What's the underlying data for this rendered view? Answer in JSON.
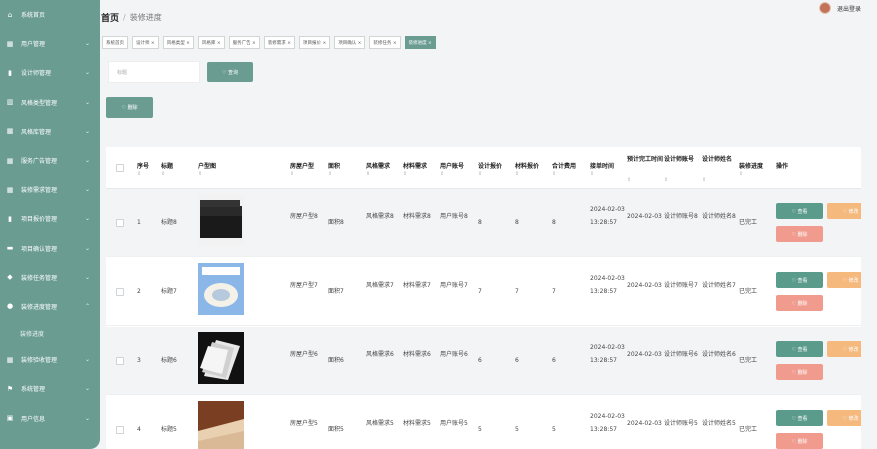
{
  "sidebar": {
    "items": [
      {
        "label": "系统首页",
        "icon": "home-icon",
        "glyph": "⌂",
        "chevron": false
      },
      {
        "label": "用户管理",
        "icon": "grid-icon",
        "glyph": "▦",
        "chevron": true
      },
      {
        "label": "设计师管理",
        "icon": "document-icon",
        "glyph": "▮",
        "chevron": true
      },
      {
        "label": "风格类型管理",
        "icon": "bar-chart-icon",
        "glyph": "▥",
        "chevron": true
      },
      {
        "label": "风格库管理",
        "icon": "grid-icon",
        "glyph": "▦",
        "chevron": true
      },
      {
        "label": "服务广告管理",
        "icon": "grid-icon",
        "glyph": "▦",
        "chevron": true
      },
      {
        "label": "装修需求管理",
        "icon": "grid-icon",
        "glyph": "▦",
        "chevron": true
      },
      {
        "label": "项目报价管理",
        "icon": "document-icon",
        "glyph": "▮",
        "chevron": true
      },
      {
        "label": "项目确认管理",
        "icon": "message-icon",
        "glyph": "▬",
        "chevron": true
      },
      {
        "label": "装修任务管理",
        "icon": "tag-icon",
        "glyph": "◆",
        "chevron": true
      },
      {
        "label": "装修进度管理",
        "icon": "person-icon",
        "glyph": "●",
        "chevron": true,
        "expanded": true
      }
    ],
    "subitem": "装修进度",
    "items_after": [
      {
        "label": "装修验收管理",
        "icon": "grid-icon",
        "glyph": "▦",
        "chevron": true
      },
      {
        "label": "系统管理",
        "icon": "flag-icon",
        "glyph": "⚑",
        "chevron": true
      },
      {
        "label": "用户信息",
        "icon": "calendar-icon",
        "glyph": "▣",
        "chevron": true
      }
    ]
  },
  "header": {
    "breadcrumb_home": "首页",
    "breadcrumb_sep": "/",
    "breadcrumb_current": "装修进度",
    "logout": "退出登录"
  },
  "tabs": [
    "系统首页",
    "设计师 ×",
    "风格类型 ×",
    "风格库 ×",
    "服务广告 ×",
    "装修需求 ×",
    "项目报价 ×",
    "项目确认 ×",
    "装修任务 ×",
    "装修进度 ×"
  ],
  "search": {
    "placeholder": "标题",
    "button": "♡ 查询"
  },
  "delete_button": "♡ 删除",
  "table": {
    "headers": [
      "序号",
      "标题",
      "户型图",
      "房屋户型",
      "面积",
      "风格需求",
      "材料需求",
      "用户账号",
      "设计报价",
      "材料报价",
      "合计费用",
      "接单时间",
      "预计完工时间",
      "设计师账号",
      "设计师姓名",
      "装修进度",
      "操作"
    ],
    "rows": [
      {
        "no": "1",
        "title": "标题8",
        "house": "房屋户型8",
        "area": "面积8",
        "style": "风格需求8",
        "material": "材料需求8",
        "account": "用户账号8",
        "design_quote": "8",
        "material_quote": "8",
        "total": "8",
        "accept_time": "2024-02-03 13:28:57",
        "finish_time": "2024-02-03",
        "designer_acct": "设计师账号8",
        "designer_name": "设计师姓名8",
        "progress": "已完工",
        "thumb": "black-foam"
      },
      {
        "no": "2",
        "title": "标题7",
        "house": "房屋户型7",
        "area": "面积7",
        "style": "风格需求7",
        "material": "材料需求7",
        "account": "用户账号7",
        "design_quote": "7",
        "material_quote": "7",
        "total": "7",
        "accept_time": "2024-02-03 13:28:57",
        "finish_time": "2024-02-03",
        "designer_acct": "设计师账号7",
        "designer_name": "设计师姓名7",
        "progress": "已完工",
        "thumb": "tape-roll"
      },
      {
        "no": "3",
        "title": "标题6",
        "house": "房屋户型6",
        "area": "面积6",
        "style": "风格需求6",
        "material": "材料需求6",
        "account": "用户账号6",
        "design_quote": "6",
        "material_quote": "6",
        "total": "6",
        "accept_time": "2024-02-03 13:28:57",
        "finish_time": "2024-02-03",
        "designer_acct": "设计师账号6",
        "designer_name": "设计师姓名6",
        "progress": "已完工",
        "thumb": "white-sheets"
      },
      {
        "no": "4",
        "title": "标题5",
        "house": "房屋户型5",
        "area": "面积5",
        "style": "风格需求5",
        "material": "材料需求5",
        "account": "用户账号5",
        "design_quote": "5",
        "material_quote": "5",
        "total": "5",
        "accept_time": "2024-02-03 13:28:57",
        "finish_time": "2024-02-03",
        "designer_acct": "设计师账号5",
        "designer_name": "设计师姓名5",
        "progress": "已完工",
        "thumb": "wood-board"
      }
    ],
    "actions": {
      "view": "♡ 查看",
      "edit": "♡ 修改",
      "delete": "♡ 删除"
    }
  },
  "colors": {
    "accent": "#6a9c92",
    "view": "#5b9b8c",
    "edit": "#f5b87d",
    "delete": "#f19a8e"
  }
}
